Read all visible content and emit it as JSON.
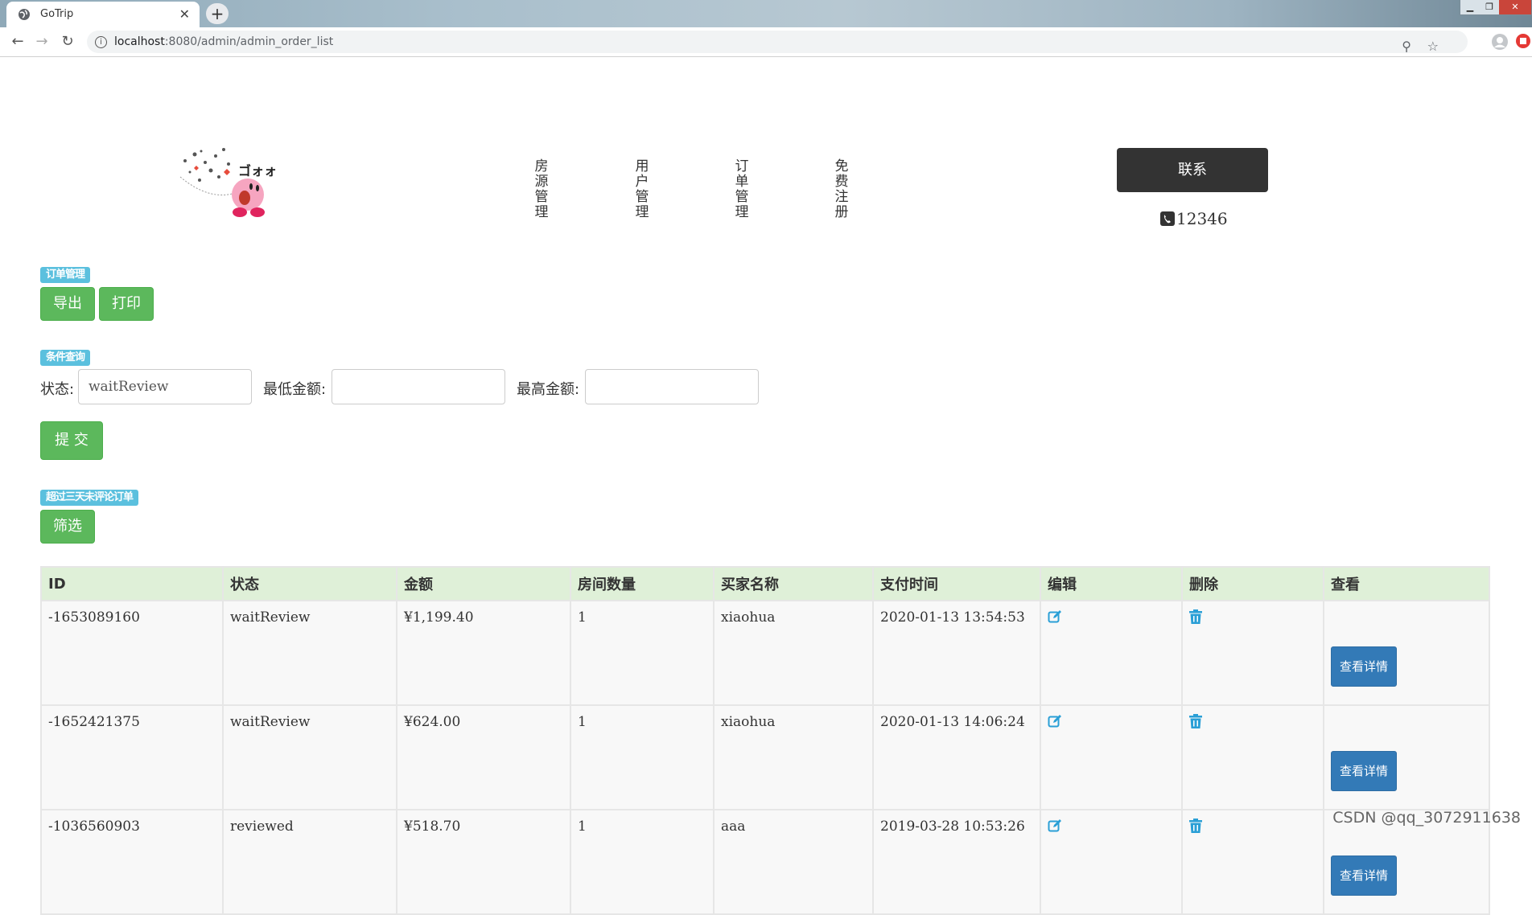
{
  "browser": {
    "tab_title": "GoTrip",
    "url_host": "localhost",
    "url_path": ":8080/admin/admin_order_list"
  },
  "nav": {
    "items": [
      "房源管理",
      "用户管理",
      "订单管理",
      "免费注册"
    ]
  },
  "contact": {
    "button_label": "联系",
    "phone": "12346"
  },
  "order_mgmt": {
    "badge": "订单管理",
    "export_label": "导出",
    "print_label": "打印"
  },
  "query": {
    "badge": "条件查询",
    "status_label": "状态:",
    "status_value": "waitReview",
    "min_label": "最低金额:",
    "min_value": "",
    "max_label": "最高金额:",
    "max_value": "",
    "submit_label": "提 交"
  },
  "filter": {
    "badge": "超过三天未评论订单",
    "button_label": "筛选"
  },
  "table": {
    "headers": [
      "ID",
      "状态",
      "金额",
      "房间数量",
      "买家名称",
      "支付时间",
      "编辑",
      "删除",
      "查看"
    ],
    "detail_label": "查看详情",
    "rows": [
      {
        "id": "-1653089160",
        "status": "waitReview",
        "amount": "¥1,199.40",
        "rooms": "1",
        "buyer": "xiaohua",
        "time": "2020-01-13 13:54:53"
      },
      {
        "id": "-1652421375",
        "status": "waitReview",
        "amount": "¥624.00",
        "rooms": "1",
        "buyer": "xiaohua",
        "time": "2020-01-13 14:06:24"
      },
      {
        "id": "-1036560903",
        "status": "reviewed",
        "amount": "¥518.70",
        "rooms": "1",
        "buyer": "aaa",
        "time": "2019-03-28 10:53:26"
      }
    ]
  },
  "watermark": "CSDN @qq_3072911638",
  "colors": {
    "success": "#5cb85c",
    "info": "#5bc0de",
    "primary": "#337ab7",
    "header_bg": "#dff0d8",
    "icon": "#2a9fd6"
  }
}
